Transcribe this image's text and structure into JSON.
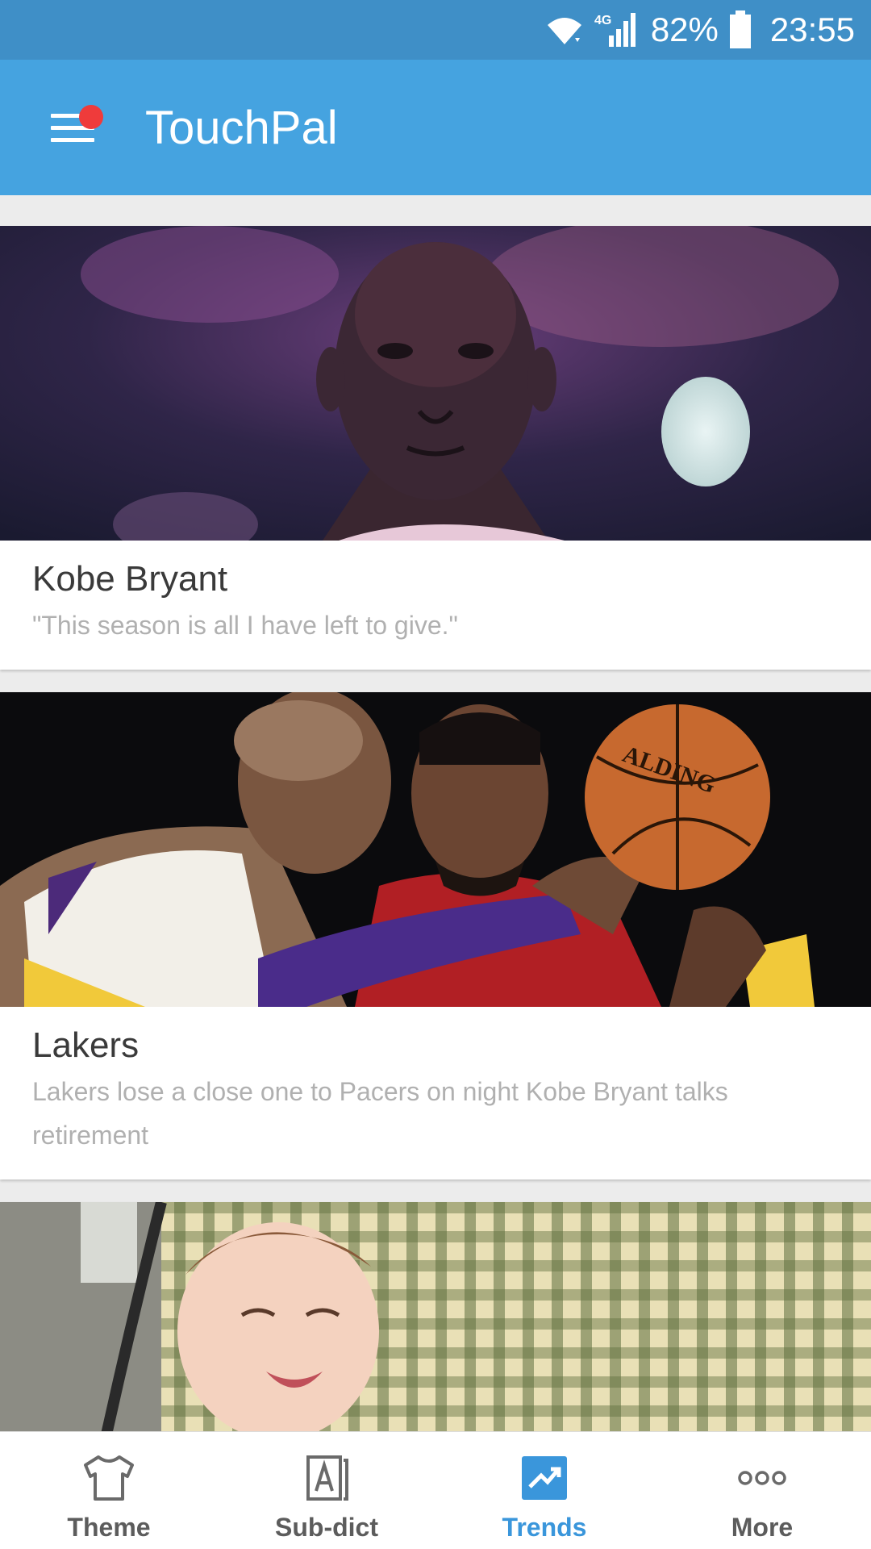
{
  "status_bar": {
    "network": "4G",
    "battery": "82%",
    "time": "23:55",
    "icons": [
      "wifi-icon",
      "signal-icon",
      "battery-icon"
    ]
  },
  "app_bar": {
    "title": "TouchPal",
    "menu_icon": "hamburger-menu-icon",
    "notification_dot_color": "#ef3b3b"
  },
  "feed": {
    "cards": [
      {
        "title": "Kobe Bryant",
        "description": "\"This season is all I have left to give.\"",
        "image": "kobe-portrait-image"
      },
      {
        "title": "Lakers",
        "description": "Lakers lose a close one to Pacers on night Kobe Bryant talks retirement",
        "image": "lakers-game-image"
      },
      {
        "title": "",
        "description": "",
        "image": "baby-photo-image"
      }
    ]
  },
  "bottom_nav": {
    "items": [
      {
        "label": "Theme",
        "icon": "shirt-icon",
        "active": false
      },
      {
        "label": "Sub-dict",
        "icon": "dictionary-icon",
        "active": false
      },
      {
        "label": "Trends",
        "icon": "trends-icon",
        "active": true
      },
      {
        "label": "More",
        "icon": "more-dots-icon",
        "active": false
      }
    ]
  },
  "colors": {
    "status_bar": "#3f8fc7",
    "app_bar": "#45a3e0",
    "accent": "#3a96db",
    "background": "#ececec"
  }
}
